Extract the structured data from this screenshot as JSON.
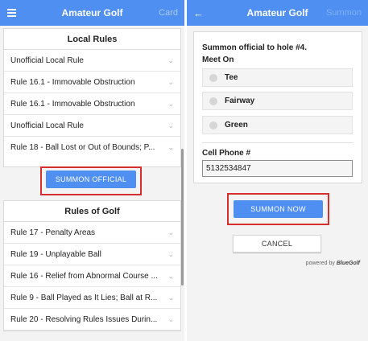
{
  "left": {
    "app_title": "Amateur Golf",
    "card_label": "Card",
    "local_rules": {
      "heading": "Local Rules",
      "items": [
        "Unofficial Local Rule",
        "Rule 16.1 - Immovable Obstruction",
        "Rule 16.1 - Immovable Obstruction",
        "Unofficial Local Rule",
        "Rule 18 - Ball Lost or Out of Bounds; P..."
      ]
    },
    "summon_button": "SUMMON OFFICIAL",
    "rules_of_golf": {
      "heading": "Rules of Golf",
      "items": [
        "Rule 17 - Penalty Areas",
        "Rule 19 - Unplayable Ball",
        "Rule 16 - Relief from Abnormal Course ...",
        "Rule 9 - Ball Played as It Lies; Ball at R...",
        "Rule 20 - Resolving Rules Issues Durin..."
      ]
    }
  },
  "right": {
    "app_title": "Amateur Golf",
    "summon_label": "Summon",
    "prompt": "Summon official to hole #4.",
    "meet_on_label": "Meet On",
    "options": [
      "Tee",
      "Fairway",
      "Green"
    ],
    "phone_label": "Cell Phone #",
    "phone_value": "5132534847",
    "summon_now": "SUMMON NOW",
    "cancel": "CANCEL",
    "powered_prefix": "powered by",
    "powered_brand": "BlueGolf"
  },
  "colors": {
    "accent": "#4f8ff1",
    "highlight": "#d42e2e"
  }
}
